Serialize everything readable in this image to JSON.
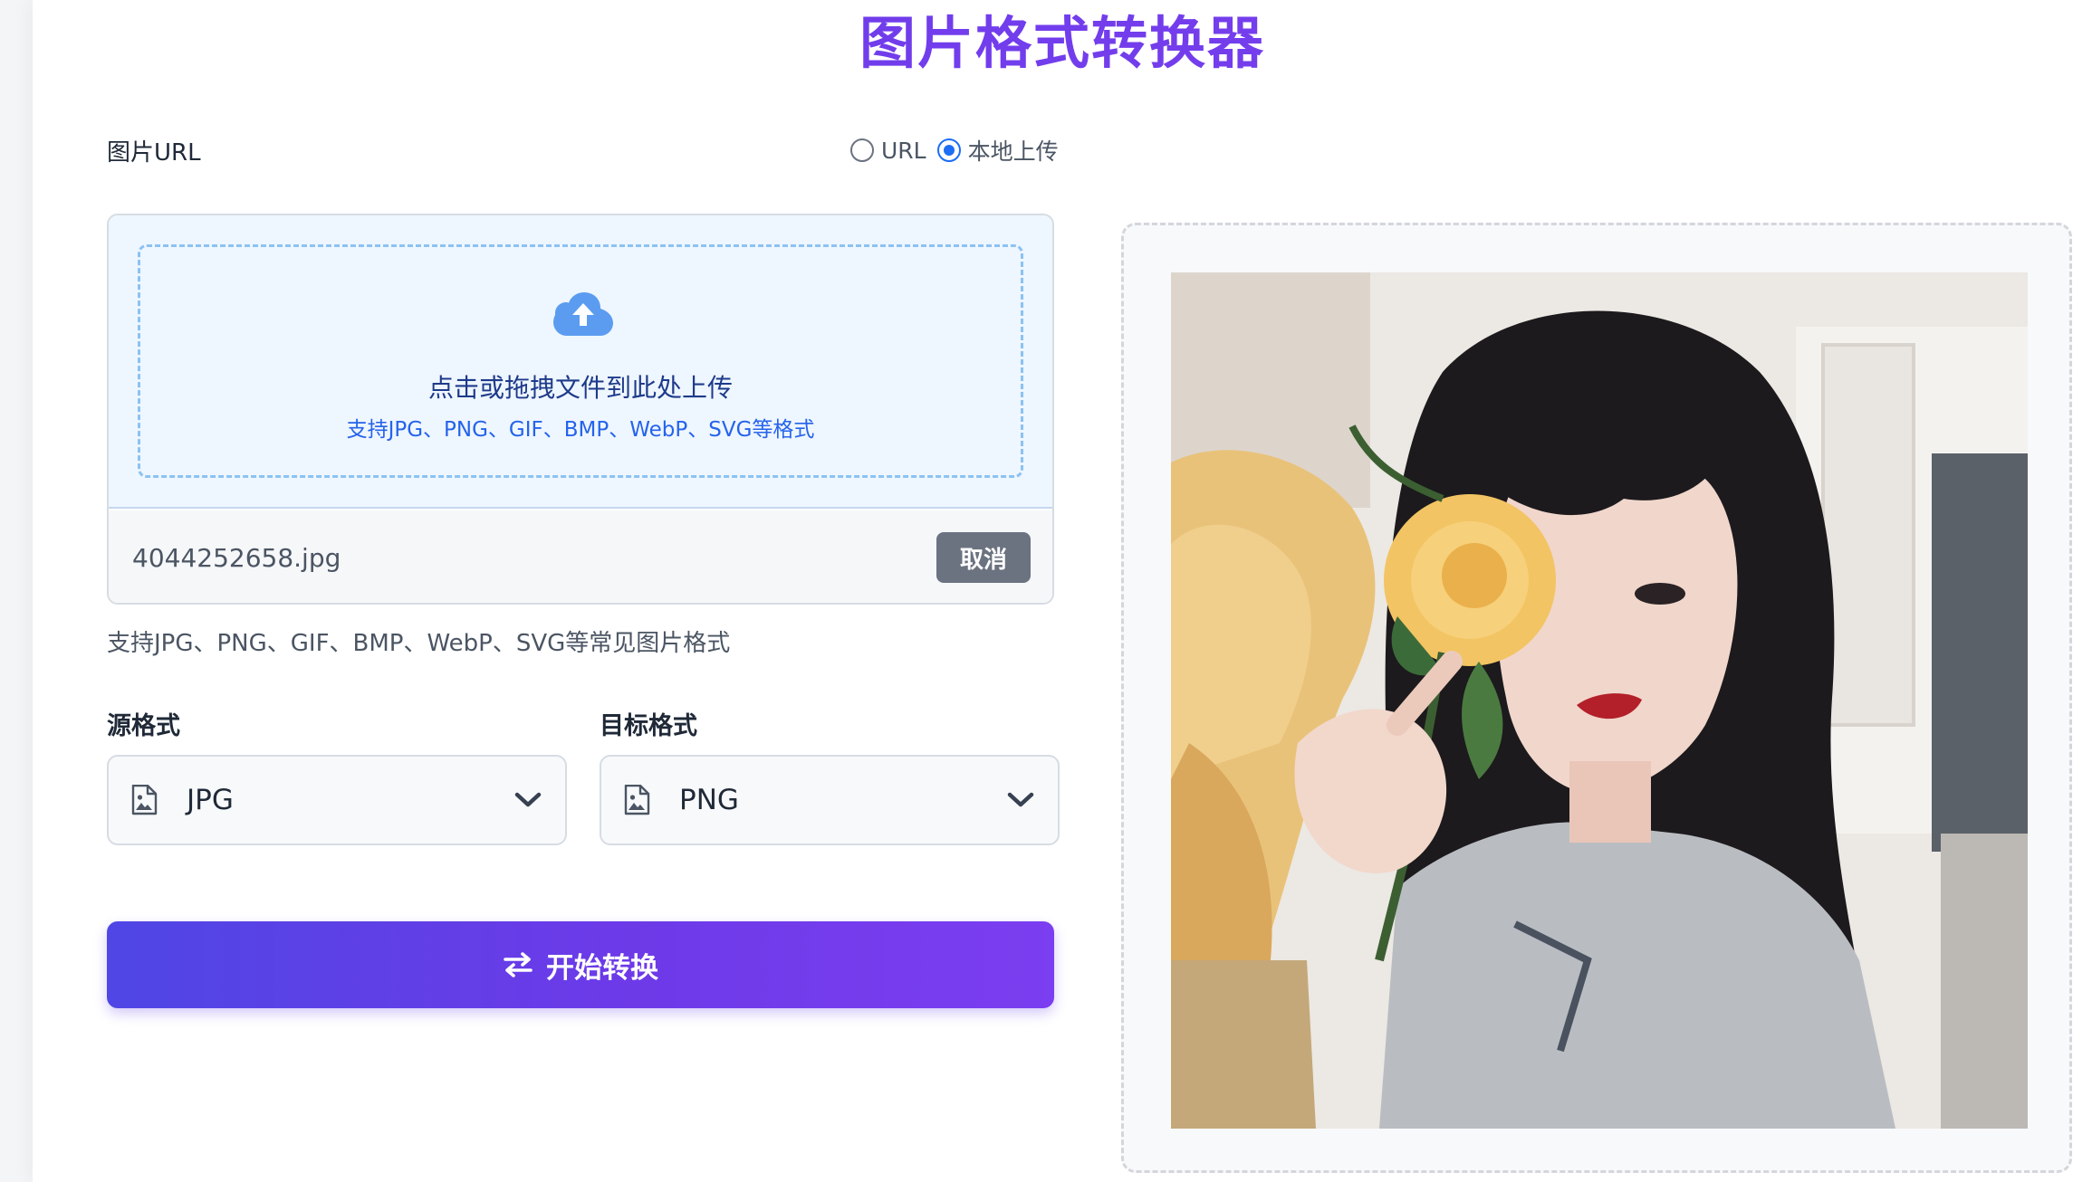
{
  "header": {
    "title": "图片格式转换器"
  },
  "source": {
    "label": "图片URL",
    "modes": [
      {
        "label": "URL",
        "checked": false
      },
      {
        "label": "本地上传",
        "checked": true
      }
    ]
  },
  "upload": {
    "icon": "cloud-upload-icon",
    "main_text": "点击或拖拽文件到此处上传",
    "sub_text": "支持JPG、PNG、GIF、BMP、WebP、SVG等格式",
    "file_name": "4044252658.jpg",
    "cancel_label": "取消",
    "hint": "支持JPG、PNG、GIF、BMP、WebP、SVG等常见图片格式"
  },
  "formats": {
    "source_label": "源格式",
    "source_value": "JPG",
    "target_label": "目标格式",
    "target_value": "PNG"
  },
  "convert": {
    "label": "开始转换",
    "icon": "swap-arrows-icon"
  },
  "colors": {
    "accent": "#6a3be8",
    "button_start": "#4f46e5",
    "button_end": "#7b3ef0",
    "dropzone_border": "#8cc2f3"
  }
}
